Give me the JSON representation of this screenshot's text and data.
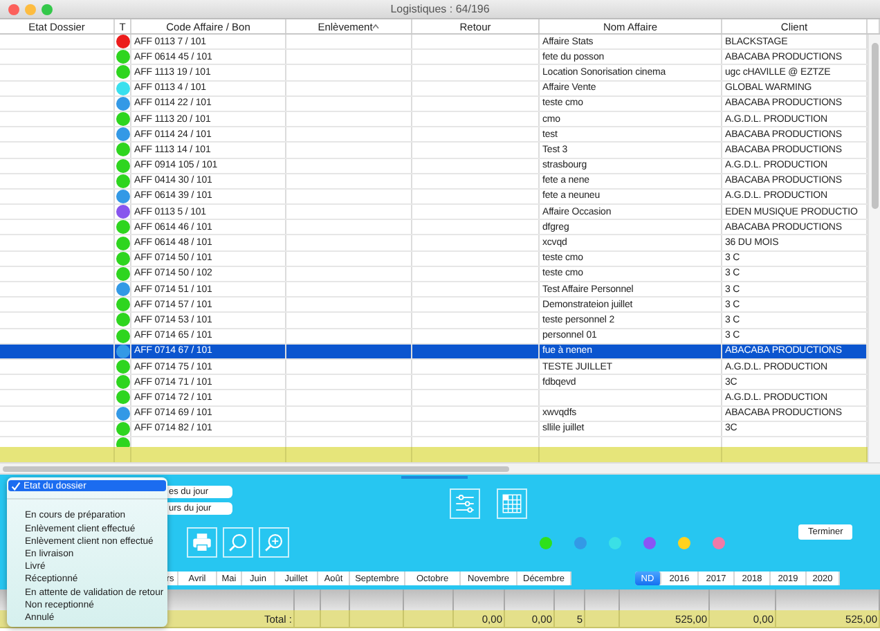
{
  "window": {
    "title": "Logistiques : 64/196"
  },
  "table": {
    "columns": [
      "Etat Dossier",
      "T",
      "Code Affaire / Bon",
      "Enlèvement",
      "Retour",
      "Nom Affaire",
      "Client"
    ],
    "rows": [
      {
        "color": "#ec1c1c",
        "code": "AFF 0113 7 / 101",
        "name": "Affaire Stats",
        "client": "BLACKSTAGE",
        "selected": false
      },
      {
        "color": "#2ed51f",
        "code": "AFF 0614 45 / 101",
        "name": "fete du posson",
        "client": "ABACABA PRODUCTIONS",
        "selected": false
      },
      {
        "color": "#2ed51f",
        "code": "AFF 1113 19 / 101",
        "name": "Location Sonorisation cinema",
        "client": "ugc cHAVILLE @ EZTZE",
        "selected": false
      },
      {
        "color": "#3ae0ee",
        "code": "AFF 0113 4 / 101",
        "name": "Affaire Vente",
        "client": "GLOBAL WARMING",
        "selected": false
      },
      {
        "color": "#3399e6",
        "code": "AFF 0114 22 / 101",
        "name": "teste cmo",
        "client": "ABACABA PRODUCTIONS",
        "selected": false
      },
      {
        "color": "#2ed51f",
        "code": "AFF 1113 20 / 101",
        "name": "cmo",
        "client": "A.G.D.L. PRODUCTION",
        "selected": false
      },
      {
        "color": "#3399e6",
        "code": "AFF 0114 24 / 101",
        "name": "test",
        "client": "ABACABA PRODUCTIONS",
        "selected": false
      },
      {
        "color": "#2ed51f",
        "code": "AFF 1113 14 / 101",
        "name": "Test 3",
        "client": "ABACABA PRODUCTIONS",
        "selected": false
      },
      {
        "color": "#2ed51f",
        "code": "AFF 0914 105 / 101",
        "name": "strasbourg",
        "client": "A.G.D.L. PRODUCTION",
        "selected": false
      },
      {
        "color": "#2ed51f",
        "code": "AFF 0414 30 / 101",
        "name": "fete a nene",
        "client": "ABACABA PRODUCTIONS",
        "selected": false
      },
      {
        "color": "#3399e6",
        "code": "AFF 0614 39 / 101",
        "name": "fete a neuneu",
        "client": "A.G.D.L. PRODUCTION",
        "selected": false
      },
      {
        "color": "#8855ee",
        "code": "AFF 0113 5 / 101",
        "name": "Affaire Occasion",
        "client": "EDEN MUSIQUE PRODUCTIO",
        "selected": false
      },
      {
        "color": "#2ed51f",
        "code": "AFF 0614 46 / 101",
        "name": "dfgreg",
        "client": "ABACABA PRODUCTIONS",
        "selected": false
      },
      {
        "color": "#2ed51f",
        "code": "AFF 0614 48 / 101",
        "name": "xcvqd",
        "client": "36 DU MOIS",
        "selected": false
      },
      {
        "color": "#2ed51f",
        "code": "AFF 0714 50 / 101",
        "name": "teste cmo",
        "client": "3 C",
        "selected": false
      },
      {
        "color": "#2ed51f",
        "code": "AFF 0714 50 / 102",
        "name": "teste cmo",
        "client": "3 C",
        "selected": false
      },
      {
        "color": "#3399e6",
        "code": "AFF 0714 51 / 101",
        "name": "Test Affaire Personnel",
        "client": "3 C",
        "selected": false
      },
      {
        "color": "#2ed51f",
        "code": "AFF 0714 57 / 101",
        "name": "Demonstrateion juillet",
        "client": "3 C",
        "selected": false
      },
      {
        "color": "#2ed51f",
        "code": "AFF 0714 53 / 101",
        "name": "teste personnel 2",
        "client": "3 C",
        "selected": false
      },
      {
        "color": "#2ed51f",
        "code": "AFF 0714 65 / 101",
        "name": "personnel 01",
        "client": "3 C",
        "selected": false
      },
      {
        "color": "#3399e6",
        "code": "AFF 0714 67 / 101",
        "name": "fue à nenen",
        "client": "ABACABA PRODUCTIONS",
        "selected": true
      },
      {
        "color": "#2ed51f",
        "code": "AFF 0714 75 / 101",
        "name": "TESTE JUILLET",
        "client": "A.G.D.L. PRODUCTION",
        "selected": false
      },
      {
        "color": "#2ed51f",
        "code": "AFF 0714 71 / 101",
        "name": "fdbqevd",
        "client": "3C",
        "selected": false
      },
      {
        "color": "#2ed51f",
        "code": "AFF 0714 72 / 101",
        "client": "A.G.D.L. PRODUCTION",
        "selected": false
      },
      {
        "color": "#3399e6",
        "code": "AFF 0714 69 / 101",
        "name": "xwvqdfs",
        "client": "ABACABA PRODUCTIONS",
        "selected": false
      },
      {
        "color": "#2ed51f",
        "code": "AFF 0714 82 / 101",
        "name": "sllile juillet",
        "client": "3C",
        "selected": false
      },
      {
        "color": "#2ed51f",
        "selected": false
      }
    ]
  },
  "panel": {
    "date_buttons": [
      "es du jour",
      "urs du jour"
    ],
    "color_filters": [
      {
        "color": "#2ee01c"
      },
      {
        "color": "#3399e6"
      },
      {
        "color": "#3ae0e6"
      },
      {
        "color": "#8a55f5"
      },
      {
        "color": "#ffd21e"
      },
      {
        "color": "#f07aa8"
      }
    ],
    "finish_button": "Terminer",
    "months": [
      {
        "label": "rs",
        "selected": false
      },
      {
        "label": "Avril",
        "selected": false
      },
      {
        "label": "Mai",
        "selected": false
      },
      {
        "label": "Juin",
        "selected": false
      },
      {
        "label": "Juillet",
        "selected": false
      },
      {
        "label": "Août",
        "selected": false
      },
      {
        "label": "Septembre",
        "selected": false
      },
      {
        "label": "Octobre",
        "selected": false
      },
      {
        "label": "Novembre",
        "selected": false
      },
      {
        "label": "Décembre",
        "selected": false
      }
    ],
    "years": [
      {
        "label": "ND",
        "selected": true
      },
      {
        "label": "2016",
        "selected": false
      },
      {
        "label": "2017",
        "selected": false
      },
      {
        "label": "2018",
        "selected": false
      },
      {
        "label": "2019",
        "selected": false
      },
      {
        "label": "2020",
        "selected": false
      }
    ]
  },
  "totals": {
    "label": "Total :",
    "values": [
      "0,00",
      "0,00",
      "5",
      "525,00",
      "0,00",
      "525,00"
    ]
  },
  "state_menu": {
    "current": {
      "label": "Etat du dossier",
      "checked": true
    },
    "items": [
      "En cours de préparation",
      "Enlèvement client effectué",
      "Enlèvement client non effectué",
      "En livraison",
      "Livré",
      "Réceptionné",
      "En attente de validation de retour",
      "Non receptionné",
      "Annulé"
    ]
  }
}
